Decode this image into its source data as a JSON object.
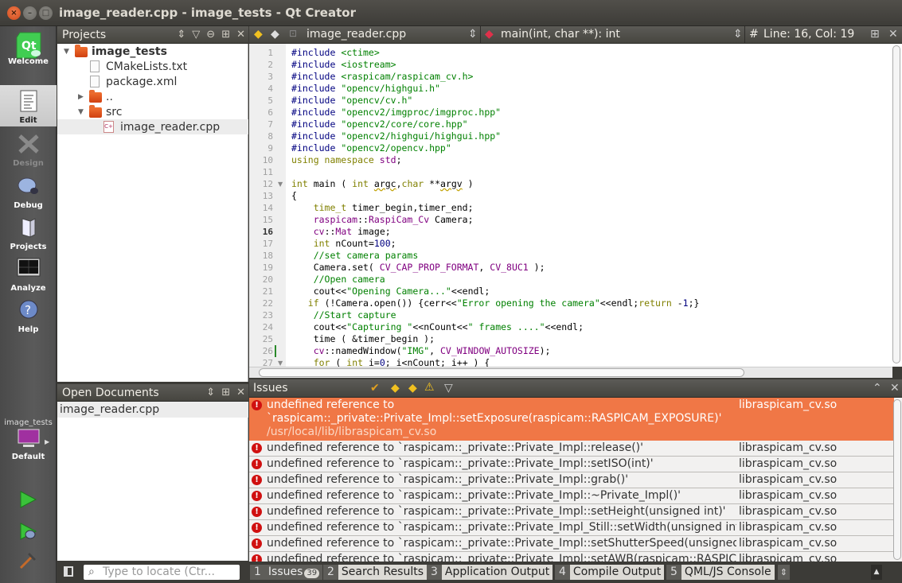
{
  "window": {
    "title": "image_reader.cpp - image_tests - Qt Creator"
  },
  "modes": [
    {
      "label": "Welcome",
      "icon": "qt-logo-icon",
      "state": "normal"
    },
    {
      "label": "Edit",
      "icon": "edit-document-icon",
      "state": "active"
    },
    {
      "label": "Design",
      "icon": "design-pencil-icon",
      "state": "disabled"
    },
    {
      "label": "Debug",
      "icon": "bug-icon",
      "state": "normal"
    },
    {
      "label": "Projects",
      "icon": "folder-book-icon",
      "state": "normal"
    },
    {
      "label": "Analyze",
      "icon": "oscilloscope-icon",
      "state": "normal"
    },
    {
      "label": "Help",
      "icon": "help-question-icon",
      "state": "normal"
    }
  ],
  "kit": {
    "project": "image_tests",
    "config": "Default"
  },
  "actions": {
    "run": "run-icon",
    "debug": "debug-run-icon",
    "build": "hammer-icon"
  },
  "projects_panel": {
    "title": "Projects",
    "tree": [
      {
        "label": "image_tests",
        "type": "project",
        "expanded": true
      },
      {
        "label": "CMakeLists.txt",
        "type": "file"
      },
      {
        "label": "package.xml",
        "type": "file"
      },
      {
        "label": "..",
        "type": "folder",
        "expanded": false
      },
      {
        "label": "src",
        "type": "folder",
        "expanded": true
      },
      {
        "label": "image_reader.cpp",
        "type": "cpp",
        "selected": true
      }
    ]
  },
  "open_documents": {
    "title": "Open Documents",
    "items": [
      "image_reader.cpp"
    ]
  },
  "editor_toolbar": {
    "file": "image_reader.cpp",
    "symbol": "main(int, char **): int",
    "hash": "#",
    "position": "Line: 16, Col: 19"
  },
  "editor": {
    "current_line": 16,
    "lines": [
      {
        "n": "1"
      },
      {
        "n": "2"
      },
      {
        "n": "3"
      },
      {
        "n": "4"
      },
      {
        "n": "5"
      },
      {
        "n": "6"
      },
      {
        "n": "7"
      },
      {
        "n": "8"
      },
      {
        "n": "9"
      },
      {
        "n": "10"
      },
      {
        "n": "11"
      },
      {
        "n": "12"
      },
      {
        "n": "13"
      },
      {
        "n": "14"
      },
      {
        "n": "15"
      },
      {
        "n": "16"
      },
      {
        "n": "17"
      },
      {
        "n": "18"
      },
      {
        "n": "19"
      },
      {
        "n": "20"
      },
      {
        "n": "21"
      },
      {
        "n": "22"
      },
      {
        "n": "23"
      },
      {
        "n": "24"
      },
      {
        "n": "25"
      },
      {
        "n": "26"
      },
      {
        "n": "27"
      }
    ],
    "code": {
      "l1": [
        "#include ",
        "<ctime>"
      ],
      "l2": [
        "#include ",
        "<iostream>"
      ],
      "l3": [
        "#include ",
        "<raspicam/raspicam_cv.h>"
      ],
      "l4": [
        "#include ",
        "\"opencv/highgui.h\""
      ],
      "l5": [
        "#include ",
        "\"opencv/cv.h\""
      ],
      "l6": [
        "#include ",
        "\"opencv2/imgproc/imgproc.hpp\""
      ],
      "l7": [
        "#include ",
        "\"opencv2/core/core.hpp\""
      ],
      "l8": [
        "#include ",
        "\"opencv2/highgui/highgui.hpp\""
      ],
      "l9": [
        "#include ",
        "\"opencv2/opencv.hpp\""
      ],
      "l10": [
        "using namespace ",
        "std",
        ";"
      ],
      "l12": [
        "int",
        " main ( ",
        "int",
        " ",
        "argc",
        ",",
        "char",
        " **",
        "argv",
        " )"
      ],
      "l13": [
        "{"
      ],
      "l14": [
        "    ",
        "time_t",
        " timer_begin,timer_end;"
      ],
      "l15": [
        "    ",
        "raspicam",
        "::",
        "RaspiCam_Cv",
        " Camera;"
      ],
      "l16": [
        "    ",
        "cv",
        "::",
        "Mat",
        " image;"
      ],
      "l17": [
        "    ",
        "int",
        " nCount=",
        "100",
        ";"
      ],
      "l18": [
        "    ",
        "//set camera params"
      ],
      "l19": [
        "    Camera.set( ",
        "CV_CAP_PROP_FORMAT",
        ", ",
        "CV_8UC1",
        " );"
      ],
      "l20": [
        "    ",
        "//Open camera"
      ],
      "l21": [
        "    cout<<",
        "\"Opening Camera...\"",
        "<<endl;"
      ],
      "l22": [
        "   ",
        "if",
        " (!Camera.open()) {cerr<<",
        "\"Error opening the camera\"",
        "<<endl;",
        "return",
        " -",
        "1",
        ";}"
      ],
      "l23": [
        "    ",
        "//Start capture"
      ],
      "l24": [
        "    cout<<",
        "\"Capturing \"",
        "<<nCount<<",
        "\" frames ....\"",
        "<<endl;"
      ],
      "l25": [
        "    time ( &timer_begin );"
      ],
      "l26": [
        "    ",
        "cv",
        "::namedWindow(",
        "\"IMG\"",
        ", ",
        "CV_WINDOW_AUTOSIZE",
        ");"
      ],
      "l27": [
        "    ",
        "for",
        " ( ",
        "int",
        " i=",
        "0",
        "; i<nCount; i++ ) {"
      ]
    }
  },
  "issues": {
    "title": "Issues",
    "rows": [
      {
        "text": "undefined reference to `raspicam::_private::Private_Impl::setExposure(raspicam::RASPICAM_EXPOSURE)'",
        "path": "/usr/local/lib/libraspicam_cv.so",
        "file": "libraspicam_cv.so",
        "selected": true
      },
      {
        "text": "undefined reference to `raspicam::_private::Private_Impl::release()'",
        "file": "libraspicam_cv.so"
      },
      {
        "text": "undefined reference to `raspicam::_private::Private_Impl::setISO(int)'",
        "file": "libraspicam_cv.so"
      },
      {
        "text": "undefined reference to `raspicam::_private::Private_Impl::grab()'",
        "file": "libraspicam_cv.so"
      },
      {
        "text": "undefined reference to `raspicam::_private::Private_Impl::~Private_Impl()'",
        "file": "libraspicam_cv.so"
      },
      {
        "text": "undefined reference to `raspicam::_private::Private_Impl::setHeight(unsigned int)'",
        "file": "libraspicam_cv.so"
      },
      {
        "text": "undefined reference to `raspicam::_private::Private_Impl_Still::setWidth(unsigned int)'",
        "file": "libraspicam_cv.so"
      },
      {
        "text": "undefined reference to `raspicam::_private::Private_Impl::setShutterSpeed(unsigned int)'",
        "file": "libraspicam_cv.so"
      },
      {
        "text": "undefined reference to `raspicam::_private::Private_Impl::setAWB(raspicam::RASPICAM_AWB)'",
        "file": "libraspicam_cv.so"
      }
    ]
  },
  "statusbar": {
    "locate_placeholder": "Type to locate (Ctr...",
    "tabs": [
      {
        "num": "1",
        "label": "Issues",
        "badge": "39",
        "active": true
      },
      {
        "num": "2",
        "label": "Search Results"
      },
      {
        "num": "3",
        "label": "Application Output"
      },
      {
        "num": "4",
        "label": "Compile Output"
      },
      {
        "num": "5",
        "label": "QML/JS Console"
      }
    ]
  }
}
